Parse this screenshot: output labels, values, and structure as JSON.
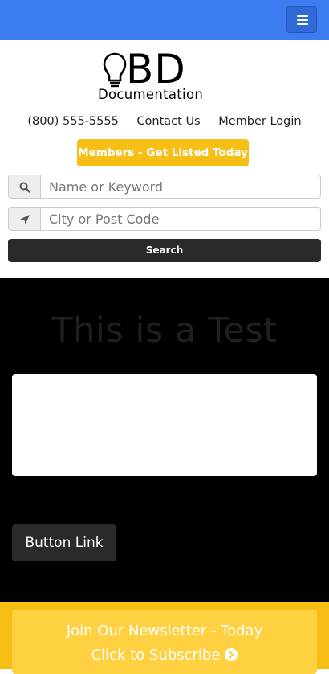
{
  "header": {
    "logo_mark": "BD",
    "logo_text": "Documentation",
    "phone": "(800) 555-5555",
    "contact": "Contact Us",
    "login": "Member Login",
    "members_button": "Members - Get Listed Today",
    "menu_icon": "hamburger-icon"
  },
  "search": {
    "keyword_placeholder": "Name or Keyword",
    "location_placeholder": "City or Post Code",
    "keyword_icon": "search-icon",
    "location_icon": "location-arrow-icon",
    "button": "Search"
  },
  "main": {
    "title": "This is a Test",
    "button_link": "Button Link"
  },
  "newsletter": {
    "line1": "Join Our Newsletter - Today",
    "line2": "Click to Subscribe",
    "icon": "chevron-circle-right-icon"
  },
  "colors": {
    "top_bar": "#3b7cf0",
    "accent_yellow": "#f7be16",
    "dark_button": "#2a2a2a",
    "section_bg": "#000000"
  }
}
